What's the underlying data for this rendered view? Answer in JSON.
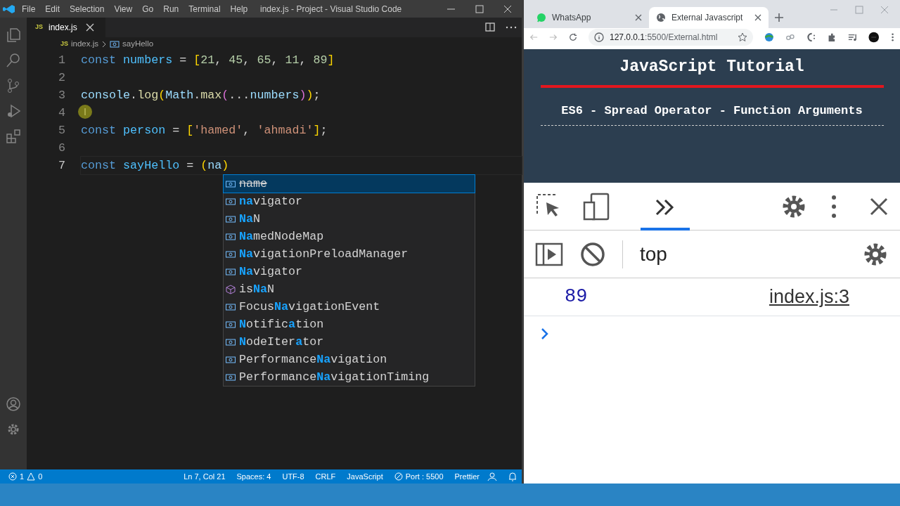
{
  "vscode": {
    "menu": [
      "File",
      "Edit",
      "Selection",
      "View",
      "Go",
      "Run",
      "Terminal",
      "Help"
    ],
    "title": "index.js - Project - Visual Studio Code",
    "tabs": [
      {
        "badge": "JS",
        "label": "index.js",
        "selected": true
      }
    ],
    "breadcrumbs": [
      {
        "kind": "file",
        "badge": "JS",
        "label": "index.js"
      },
      {
        "kind": "symbol",
        "label": "sayHello"
      }
    ],
    "lines": [
      {
        "number": "1",
        "current": false,
        "text": "const numbers = [21, 45, 65, 11, 89]"
      },
      {
        "number": "2",
        "current": false
      },
      {
        "number": "3",
        "current": false,
        "text": "console.log(Math.max(...numbers));"
      },
      {
        "number": "4",
        "current": false
      },
      {
        "number": "5",
        "current": false,
        "text": "const person = ['hamed', 'ahmadi'];"
      },
      {
        "number": "6",
        "current": false
      },
      {
        "number": "7",
        "current": true,
        "text": "const sayHello = (na)"
      }
    ],
    "suggestions": [
      {
        "kind": "variable",
        "selected": true,
        "deprecated": true,
        "label": "name"
      },
      {
        "kind": "variable",
        "selected": false,
        "deprecated": false,
        "label": "**na**vigator"
      },
      {
        "kind": "variable",
        "selected": false,
        "deprecated": false,
        "label": "**Na**N"
      },
      {
        "kind": "variable",
        "selected": false,
        "deprecated": false,
        "label": "**Na**medNodeMap"
      },
      {
        "kind": "variable",
        "selected": false,
        "deprecated": false,
        "label": "**Na**vigationPreloadManager"
      },
      {
        "kind": "variable",
        "selected": false,
        "deprecated": false,
        "label": "**Na**vigator"
      },
      {
        "kind": "method",
        "selected": false,
        "deprecated": false,
        "label": "is**Na**N"
      },
      {
        "kind": "variable",
        "selected": false,
        "deprecated": false,
        "label": "Focus**Na**vigationEvent"
      },
      {
        "kind": "variable",
        "selected": false,
        "deprecated": false,
        "label": "**N**otific**a**tion"
      },
      {
        "kind": "variable",
        "selected": false,
        "deprecated": false,
        "label": "**N**odeIter**a**tor"
      },
      {
        "kind": "variable",
        "selected": false,
        "deprecated": false,
        "label": "Performance**Na**vigation"
      },
      {
        "kind": "variable",
        "selected": false,
        "deprecated": false,
        "label": "Performance**Na**vigationTiming"
      }
    ],
    "status_bar": {
      "errors": "1",
      "warnings": "0",
      "items": [
        {
          "kind": "text",
          "text": "Ln 7, Col 21"
        },
        {
          "kind": "text",
          "text": "Spaces: 4"
        },
        {
          "kind": "text",
          "text": "UTF-8"
        },
        {
          "kind": "text",
          "text": "CRLF"
        },
        {
          "kind": "text",
          "text": "JavaScript"
        },
        {
          "kind": "port",
          "text": "Port : 5500"
        },
        {
          "kind": "text",
          "text": "Prettier"
        }
      ]
    }
  },
  "chrome": {
    "tabs": [
      {
        "title": "WhatsApp",
        "selected": false
      },
      {
        "title": "External Javascript",
        "selected": true
      }
    ],
    "url": {
      "host": "127.0.0.1",
      "path": ":5500/External.html"
    },
    "page": {
      "heading": "JavaScript Tutorial",
      "subheading": "ES6 - Spread Operator - Function Arguments"
    },
    "devtools": {
      "context": "top",
      "console": [
        {
          "value": "89",
          "source": "index.js:3"
        }
      ]
    }
  }
}
